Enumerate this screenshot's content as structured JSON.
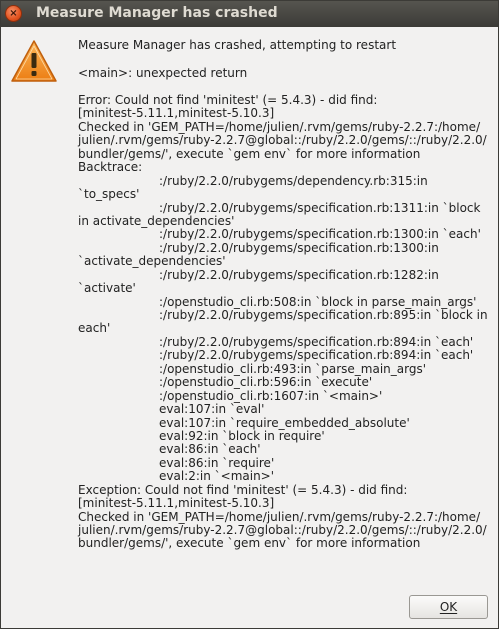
{
  "window": {
    "title": "Measure Manager has crashed",
    "close_glyph": "×"
  },
  "dialog": {
    "icon": "warning-icon",
    "message": "Measure Manager has crashed, attempting to restart",
    "sub_message": "<main>: unexpected return",
    "details_lines": [
      {
        "text": "Error: Could not find 'minitest' (= 5.4.3) - did find:",
        "indent": false
      },
      {
        "text": "[minitest-5.11.1,minitest-5.10.3]",
        "indent": false
      },
      {
        "text": "Checked in 'GEM_PATH=/home/julien/.rvm/gems/ruby-2.2.7:/home/",
        "indent": false
      },
      {
        "text": "julien/.rvm/gems/ruby-2.2.7@global::/ruby/2.2.0/gems/::/ruby/2.2.0/",
        "indent": false
      },
      {
        "text": "bundler/gems/', execute `gem env` for more information",
        "indent": false
      },
      {
        "text": "Backtrace:",
        "indent": false
      },
      {
        "text": ":/ruby/2.2.0/rubygems/dependency.rb:315:in",
        "indent": true
      },
      {
        "text": "`to_specs'",
        "indent": false
      },
      {
        "text": ":/ruby/2.2.0/rubygems/specification.rb:1311:in `block",
        "indent": true
      },
      {
        "text": "in activate_dependencies'",
        "indent": false
      },
      {
        "text": ":/ruby/2.2.0/rubygems/specification.rb:1300:in `each'",
        "indent": true
      },
      {
        "text": ":/ruby/2.2.0/rubygems/specification.rb:1300:in",
        "indent": true
      },
      {
        "text": "`activate_dependencies'",
        "indent": false
      },
      {
        "text": ":/ruby/2.2.0/rubygems/specification.rb:1282:in",
        "indent": true
      },
      {
        "text": "`activate'",
        "indent": false
      },
      {
        "text": ":/openstudio_cli.rb:508:in `block in parse_main_args'",
        "indent": true
      },
      {
        "text": ":/ruby/2.2.0/rubygems/specification.rb:895:in `block in",
        "indent": true
      },
      {
        "text": "each'",
        "indent": false
      },
      {
        "text": ":/ruby/2.2.0/rubygems/specification.rb:894:in `each'",
        "indent": true
      },
      {
        "text": ":/ruby/2.2.0/rubygems/specification.rb:894:in `each'",
        "indent": true
      },
      {
        "text": ":/openstudio_cli.rb:493:in `parse_main_args'",
        "indent": true
      },
      {
        "text": ":/openstudio_cli.rb:596:in `execute'",
        "indent": true
      },
      {
        "text": ":/openstudio_cli.rb:1607:in `<main>'",
        "indent": true
      },
      {
        "text": "eval:107:in `eval'",
        "indent": true
      },
      {
        "text": "eval:107:in `require_embedded_absolute'",
        "indent": true
      },
      {
        "text": "eval:92:in `block in require'",
        "indent": true
      },
      {
        "text": "eval:86:in `each'",
        "indent": true
      },
      {
        "text": "eval:86:in `require'",
        "indent": true
      },
      {
        "text": "eval:2:in `<main>'",
        "indent": true
      },
      {
        "text": "Exception: Could not find 'minitest' (= 5.4.3) - did find:",
        "indent": false
      },
      {
        "text": "[minitest-5.11.1,minitest-5.10.3]",
        "indent": false
      },
      {
        "text": "Checked in 'GEM_PATH=/home/julien/.rvm/gems/ruby-2.2.7:/home/",
        "indent": false
      },
      {
        "text": "julien/.rvm/gems/ruby-2.2.7@global::/ruby/2.2.0/gems/::/ruby/2.2.0/",
        "indent": false
      },
      {
        "text": "bundler/gems/', execute `gem env` for more information",
        "indent": false
      }
    ],
    "ok_label": "OK"
  },
  "colors": {
    "titlebar": "#3c3b37",
    "close_button": "#e2531f",
    "warning_fill": "#f59a2f",
    "background": "#f2f1f0"
  }
}
